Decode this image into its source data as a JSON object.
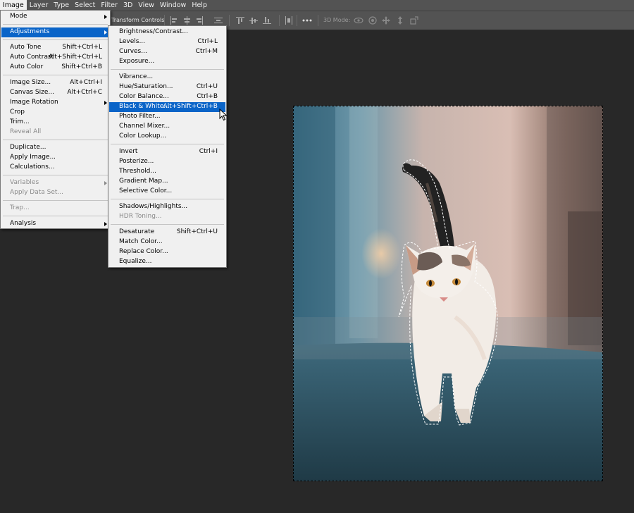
{
  "menubar": {
    "items": [
      "Image",
      "Layer",
      "Type",
      "Select",
      "Filter",
      "3D",
      "View",
      "Window",
      "Help"
    ],
    "active": "Image"
  },
  "options_bar": {
    "transform_controls": "Transform Controls",
    "mode_3d": "3D Mode:"
  },
  "image_menu": {
    "items": [
      {
        "label": "Mode",
        "submenu": true
      },
      {
        "label": "Adjustments",
        "submenu": true,
        "highlighted": true
      },
      {
        "label": "Auto Tone",
        "shortcut": "Shift+Ctrl+L"
      },
      {
        "label": "Auto Contrast",
        "shortcut": "Alt+Shift+Ctrl+L"
      },
      {
        "label": "Auto Color",
        "shortcut": "Shift+Ctrl+B"
      },
      {
        "label": "Image Size...",
        "shortcut": "Alt+Ctrl+I"
      },
      {
        "label": "Canvas Size...",
        "shortcut": "Alt+Ctrl+C"
      },
      {
        "label": "Image Rotation",
        "submenu": true
      },
      {
        "label": "Crop"
      },
      {
        "label": "Trim..."
      },
      {
        "label": "Reveal All",
        "disabled": true
      },
      {
        "label": "Duplicate..."
      },
      {
        "label": "Apply Image..."
      },
      {
        "label": "Calculations..."
      },
      {
        "label": "Variables",
        "submenu": true,
        "disabled": true
      },
      {
        "label": "Apply Data Set...",
        "disabled": true
      },
      {
        "label": "Trap...",
        "disabled": true
      },
      {
        "label": "Analysis",
        "submenu": true
      }
    ]
  },
  "adjustments_menu": {
    "items": [
      {
        "label": "Brightness/Contrast..."
      },
      {
        "label": "Levels...",
        "shortcut": "Ctrl+L"
      },
      {
        "label": "Curves...",
        "shortcut": "Ctrl+M"
      },
      {
        "label": "Exposure..."
      },
      {
        "label": "Vibrance..."
      },
      {
        "label": "Hue/Saturation...",
        "shortcut": "Ctrl+U"
      },
      {
        "label": "Color Balance...",
        "shortcut": "Ctrl+B"
      },
      {
        "label": "Black & White...",
        "shortcut": "Alt+Shift+Ctrl+B",
        "highlighted": true
      },
      {
        "label": "Photo Filter..."
      },
      {
        "label": "Channel Mixer..."
      },
      {
        "label": "Color Lookup..."
      },
      {
        "label": "Invert",
        "shortcut": "Ctrl+I"
      },
      {
        "label": "Posterize..."
      },
      {
        "label": "Threshold..."
      },
      {
        "label": "Gradient Map..."
      },
      {
        "label": "Selective Color..."
      },
      {
        "label": "Shadows/Highlights..."
      },
      {
        "label": "HDR Toning...",
        "disabled": true
      },
      {
        "label": "Desaturate",
        "shortcut": "Shift+Ctrl+U"
      },
      {
        "label": "Match Color..."
      },
      {
        "label": "Replace Color..."
      },
      {
        "label": "Equalize..."
      }
    ]
  },
  "icons": {
    "align_buttons": [
      "align-left-icon",
      "align-center-icon",
      "align-right-icon",
      "distribute-icon",
      "align-top-icon",
      "align-middle-icon",
      "align-bottom-icon"
    ],
    "more": "more-icon",
    "mode_3d_buttons": [
      "orbit-3d-icon",
      "roll-3d-icon",
      "drag-3d-icon",
      "slide-3d-icon",
      "scale-3d-icon"
    ]
  },
  "colors": {
    "menu_highlight": "#0a64c8",
    "workspace": "#282828",
    "panel": "#535353"
  }
}
